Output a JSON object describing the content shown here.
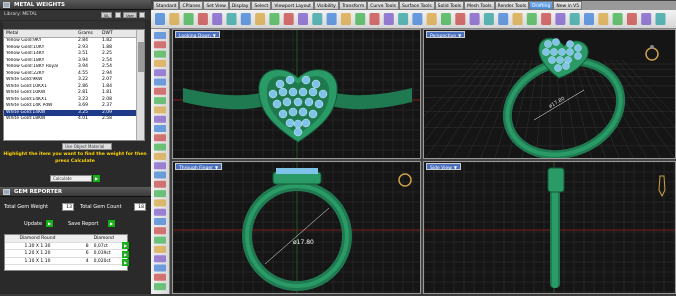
{
  "left_panel": {
    "metal_weights": {
      "title": "METAL WEIGHTS",
      "library": "Library: METAL",
      "sil_label": "SIL",
      "user_label": "User",
      "columns": [
        "Metal",
        "Grams",
        "DWT"
      ],
      "rows": [
        {
          "metal": "Yellow Gold:9KY",
          "grams": "2.84",
          "dwt": "1.82",
          "selected": false
        },
        {
          "metal": "Yellow Gold:10KY",
          "grams": "2.93",
          "dwt": "1.88",
          "selected": false
        },
        {
          "metal": "Yellow Gold:14KY",
          "grams": "3.51",
          "dwt": "2.25",
          "selected": false
        },
        {
          "metal": "Yellow Gold:18KY",
          "grams": "3.94",
          "dwt": "2.54",
          "selected": false
        },
        {
          "metal": "Yellow Gold:18KY Royal",
          "grams": "3.94",
          "dwt": "2.54",
          "selected": false
        },
        {
          "metal": "Yellow Gold:22KY",
          "grams": "4.55",
          "dwt": "2.94",
          "selected": false
        },
        {
          "metal": "White Gold:9KW",
          "grams": "3.22",
          "dwt": "2.07",
          "selected": false
        },
        {
          "metal": "White Gold:10KX1",
          "grams": "2.86",
          "dwt": "1.84",
          "selected": false
        },
        {
          "metal": "White Gold:10KW",
          "grams": "2.81",
          "dwt": "1.81",
          "selected": false
        },
        {
          "metal": "White Gold:14KX1",
          "grams": "3.23",
          "dwt": "2.08",
          "selected": false
        },
        {
          "metal": "White Gold:14K PdW",
          "grams": "3.69",
          "dwt": "2.37",
          "selected": false
        },
        {
          "metal": "White Gold:14KW",
          "grams": "3.25",
          "dwt": "2.09",
          "selected": true
        },
        {
          "metal": "White Gold:18KW",
          "grams": "4.01",
          "dwt": "2.58",
          "selected": false
        }
      ],
      "object_dropdown": "Use Object Material",
      "hint": "Highlight the item you want to find the weight for then press Calculate",
      "calculate_label": "Calculate"
    },
    "gem_reporter": {
      "title": "GEM REPORTER",
      "total_gem_weight_label": "Total Gem Weight",
      "total_gem_weight": "13",
      "total_gem_count_label": "Total Gem Count",
      "total_gem_count": "18",
      "update_label": "Update",
      "save_report_label": "Save Report",
      "columns": [
        "Diamond Round",
        "",
        "Diamond"
      ],
      "rows": [
        {
          "size": "1.30 X 1.30",
          "count": "8",
          "weight": "0,07ct"
        },
        {
          "size": "1.20 X 1.20",
          "count": "6",
          "weight": "0,039ct"
        },
        {
          "size": "1.10 X 1.10",
          "count": "4",
          "weight": "0,020ct"
        }
      ]
    }
  },
  "tabs": [
    "Standard",
    "CPlanes",
    "Set View",
    "Display",
    "Select",
    "Viewport Layout",
    "Visibility",
    "Transform",
    "Curve Tools",
    "Surface Tools",
    "Solid Tools",
    "Mesh Tools",
    "Render Tools",
    "Drafting",
    "New in V5"
  ],
  "active_tab": "Drafting",
  "viewports": [
    {
      "label": "Looking Down"
    },
    {
      "label": "Perspective",
      "dimension": "ø17.80"
    },
    {
      "label": "Through Finger",
      "dimension": "ø17.80"
    },
    {
      "label": "Side View"
    }
  ],
  "colors": {
    "ring": "#1f8a5e",
    "gem": "#7fc4e8",
    "grid": "#3a3a3a",
    "axis_red": "#a52020",
    "axis_green": "#1c6b1c",
    "accent": "#ffd400"
  }
}
